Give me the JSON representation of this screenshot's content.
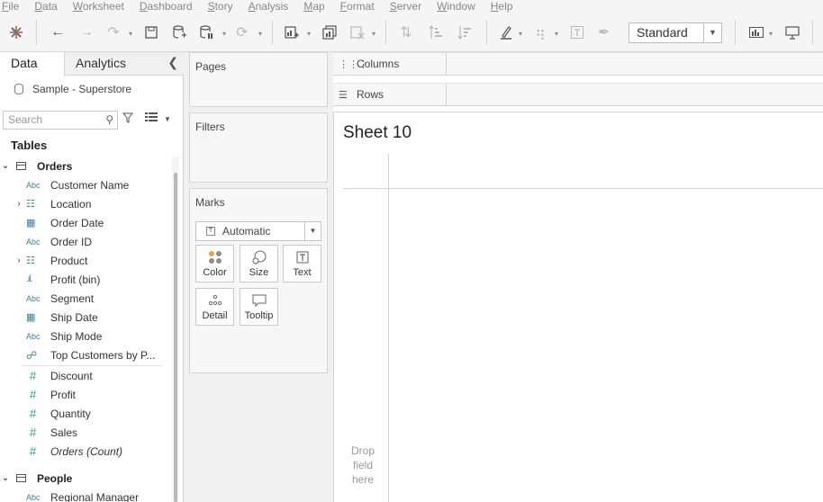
{
  "menu": [
    "File",
    "Data",
    "Worksheet",
    "Dashboard",
    "Story",
    "Analysis",
    "Map",
    "Format",
    "Server",
    "Window",
    "Help"
  ],
  "toolbar": {
    "fit_select": "Standard"
  },
  "left_pane": {
    "tabs": {
      "data": "Data",
      "analytics": "Analytics"
    },
    "datasource": "Sample - Superstore",
    "search_placeholder": "Search",
    "tables_heading": "Tables",
    "tables": [
      {
        "name": "Orders",
        "fields": [
          {
            "type": "Abc",
            "label": "Customer Name"
          },
          {
            "type": "hierarchy",
            "label": "Location",
            "expandable": true
          },
          {
            "type": "date",
            "label": "Order Date"
          },
          {
            "type": "Abc",
            "label": "Order ID"
          },
          {
            "type": "hierarchy",
            "label": "Product",
            "expandable": true
          },
          {
            "type": "bin",
            "label": "Profit (bin)"
          },
          {
            "type": "Abc",
            "label": "Segment"
          },
          {
            "type": "date",
            "label": "Ship Date"
          },
          {
            "type": "Abc",
            "label": "Ship Mode"
          },
          {
            "type": "set",
            "label": "Top Customers by P..."
          }
        ],
        "measures": [
          {
            "type": "#",
            "label": "Discount"
          },
          {
            "type": "#",
            "label": "Profit"
          },
          {
            "type": "#",
            "label": "Quantity"
          },
          {
            "type": "#",
            "label": "Sales"
          },
          {
            "type": "#",
            "label": "Orders (Count)",
            "italic": true
          }
        ]
      },
      {
        "name": "People",
        "fields": [
          {
            "type": "Abc",
            "label": "Regional Manager"
          }
        ]
      }
    ]
  },
  "cards": {
    "pages": "Pages",
    "filters": "Filters",
    "marks": "Marks",
    "mark_type": "Automatic",
    "mark_buttons": [
      "Color",
      "Size",
      "Text",
      "Detail",
      "Tooltip"
    ]
  },
  "shelves": {
    "columns": "Columns",
    "rows": "Rows"
  },
  "view": {
    "sheet_title": "Sheet 10",
    "drop_hint": "Drop field here"
  }
}
